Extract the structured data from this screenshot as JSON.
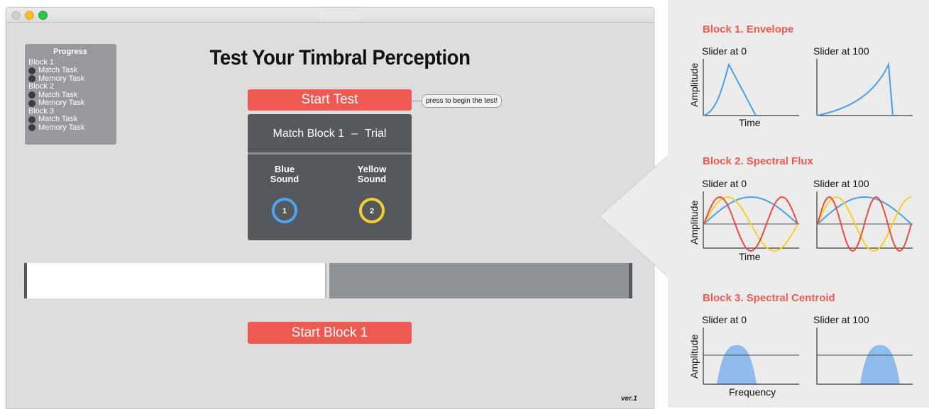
{
  "window": {
    "title": "",
    "progress": {
      "title": "Progress",
      "blocks": [
        {
          "label": "Block 1",
          "tasks": [
            "Match Task",
            "Memory Task"
          ]
        },
        {
          "label": "Block 2",
          "tasks": [
            "Match Task",
            "Memory Task"
          ]
        },
        {
          "label": "Block 3",
          "tasks": [
            "Match Task",
            "Memory Task"
          ]
        }
      ]
    },
    "main_title": "Test Your Timbral Perception",
    "start_test_label": "Start Test",
    "hint_bubble": "press to begin the test!",
    "trial": {
      "block_label": "Match Block 1",
      "dash": "–",
      "trial_label": "Trial",
      "blue_label_1": "Blue",
      "blue_label_2": "Sound",
      "yellow_label_1": "Yellow",
      "yellow_label_2": "Sound",
      "blue_number": "1",
      "yellow_number": "2"
    },
    "slider_value_fraction": 0.5,
    "start_block_label": "Start Block 1",
    "version": "ver.1"
  },
  "explanation": {
    "block1": {
      "title": "Block 1. Envelope",
      "left_caption": "Slider at 0",
      "right_caption": "Slider at 100",
      "ylabel": "Amplitude",
      "xlabel": "Time"
    },
    "block2": {
      "title": "Block 2. Spectral Flux",
      "left_caption": "Slider at 0",
      "right_caption": "Slider at 100",
      "ylabel": "Amplitude",
      "xlabel": "Time"
    },
    "block3": {
      "title": "Block 3. Spectral Centroid",
      "left_caption": "Slider at 0",
      "right_caption": "Slider at 100",
      "ylabel": "Amplitude",
      "xlabel": "Frequency"
    }
  },
  "colors": {
    "accent_red": "#ee5a52",
    "title_red": "#ef5a4e",
    "blue": "#4fa4f1",
    "yellow": "#f5cf31",
    "wave_red": "#ea4b3f",
    "wave_yellow": "#f6d126",
    "wave_blue": "#4b9fe8",
    "centroid_fill": "#8fbcec"
  }
}
